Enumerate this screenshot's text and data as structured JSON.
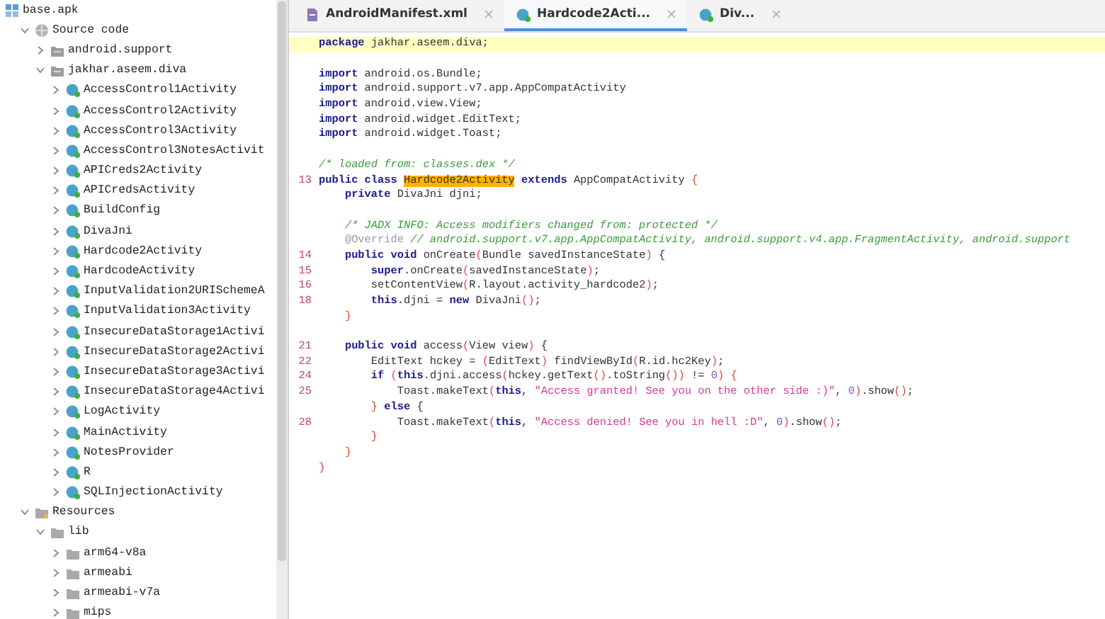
{
  "tree": {
    "label": "base.apk",
    "kind": "apk",
    "children": [
      {
        "label": "Source code",
        "kind": "source",
        "expanded": true,
        "children": [
          {
            "label": "android.support",
            "kind": "package",
            "expanded": false
          },
          {
            "label": "jakhar.aseem.diva",
            "kind": "package",
            "expanded": true,
            "children": [
              {
                "label": "AccessControl1Activity",
                "kind": "class",
                "expanded": false
              },
              {
                "label": "AccessControl2Activity",
                "kind": "class",
                "expanded": false
              },
              {
                "label": "AccessControl3Activity",
                "kind": "class",
                "expanded": false
              },
              {
                "label": "AccessControl3NotesActivit",
                "kind": "class",
                "expanded": false
              },
              {
                "label": "APICreds2Activity",
                "kind": "class",
                "expanded": false
              },
              {
                "label": "APICredsActivity",
                "kind": "class",
                "expanded": false
              },
              {
                "label": "BuildConfig",
                "kind": "class",
                "expanded": false
              },
              {
                "label": "DivaJni",
                "kind": "class",
                "expanded": false
              },
              {
                "label": "Hardcode2Activity",
                "kind": "class",
                "expanded": false
              },
              {
                "label": "HardcodeActivity",
                "kind": "class",
                "expanded": false
              },
              {
                "label": "InputValidation2URISchemeA",
                "kind": "class",
                "expanded": false
              },
              {
                "label": "InputValidation3Activity",
                "kind": "class",
                "expanded": false
              },
              {
                "label": "InsecureDataStorage1Activi",
                "kind": "class",
                "expanded": false
              },
              {
                "label": "InsecureDataStorage2Activi",
                "kind": "class",
                "expanded": false
              },
              {
                "label": "InsecureDataStorage3Activi",
                "kind": "class",
                "expanded": false
              },
              {
                "label": "InsecureDataStorage4Activi",
                "kind": "class",
                "expanded": false
              },
              {
                "label": "LogActivity",
                "kind": "class",
                "expanded": false
              },
              {
                "label": "MainActivity",
                "kind": "class",
                "expanded": false
              },
              {
                "label": "NotesProvider",
                "kind": "class",
                "expanded": false
              },
              {
                "label": "R",
                "kind": "class",
                "expanded": false
              },
              {
                "label": "SQLInjectionActivity",
                "kind": "class",
                "expanded": false
              }
            ]
          }
        ]
      },
      {
        "label": "Resources",
        "kind": "resources",
        "expanded": true,
        "children": [
          {
            "label": "lib",
            "kind": "folder",
            "expanded": true,
            "children": [
              {
                "label": "arm64-v8a",
                "kind": "folder",
                "expanded": false
              },
              {
                "label": "armeabi",
                "kind": "folder",
                "expanded": false
              },
              {
                "label": "armeabi-v7a",
                "kind": "folder",
                "expanded": false
              },
              {
                "label": "mips",
                "kind": "folder",
                "expanded": false
              }
            ]
          }
        ]
      }
    ]
  },
  "tabs": [
    {
      "label": "AndroidManifest.xml",
      "kind": "xml",
      "selected": false
    },
    {
      "label": "Hardcode2Acti...",
      "kind": "class",
      "selected": true
    },
    {
      "label": "Div...",
      "kind": "class",
      "selected": false
    }
  ],
  "code": {
    "lines": [
      {
        "current": true,
        "tokens": [
          {
            "kind": "kw",
            "text": "package"
          },
          {
            "kind": "plain",
            "text": " jakhar.aseem.diva;"
          }
        ]
      },
      {
        "current": false
      },
      {
        "current": false,
        "tokens": [
          {
            "kind": "kw",
            "text": "import"
          },
          {
            "kind": "plain",
            "text": " android.os.Bundle;"
          }
        ]
      },
      {
        "current": false,
        "tokens": [
          {
            "kind": "kw",
            "text": "import"
          },
          {
            "kind": "plain",
            "text": " android.support.v7.app.AppCompatActivity"
          }
        ]
      },
      {
        "current": false,
        "tokens": [
          {
            "kind": "kw",
            "text": "import"
          },
          {
            "kind": "plain",
            "text": " android.view.View;"
          }
        ]
      },
      {
        "current": false,
        "tokens": [
          {
            "kind": "kw",
            "text": "import"
          },
          {
            "kind": "plain",
            "text": " android.widget.EditText;"
          }
        ]
      },
      {
        "current": false,
        "tokens": [
          {
            "kind": "kw",
            "text": "import"
          },
          {
            "kind": "plain",
            "text": " android.widget.Toast;"
          }
        ]
      },
      {
        "current": false
      },
      {
        "current": false,
        "tokens": [
          {
            "kind": "comment",
            "text": "/* loaded from: classes.dex */"
          }
        ]
      },
      {
        "number": "13",
        "current": false,
        "tokens": [
          {
            "kind": "kw",
            "text": "public class "
          },
          {
            "kind": "match",
            "text": "Hardcode2Activity"
          },
          {
            "kind": "kw",
            "text": " extends"
          },
          {
            "kind": "plain",
            "text": " AppCompatActivity "
          },
          {
            "kind": "paren",
            "text": "{"
          }
        ]
      },
      {
        "current": false,
        "tokens": [
          {
            "kind": "kw",
            "text": "    private"
          },
          {
            "kind": "plain",
            "text": " DivaJni djni;"
          }
        ]
      },
      {
        "current": false
      },
      {
        "current": false,
        "tokens": [
          {
            "kind": "comment",
            "text": "    /* JADX INFO: Access modifiers changed from: protected */"
          }
        ]
      },
      {
        "current": false,
        "tokens": [
          {
            "kind": "anno",
            "text": "    @Override"
          },
          {
            "kind": "comment",
            "text": " // android.support.v7.app.AppCompatActivity, android.support.v4.app.FragmentActivity, android.support"
          }
        ]
      },
      {
        "number": "14",
        "current": false,
        "tokens": [
          {
            "kind": "kw",
            "text": "    public void"
          },
          {
            "kind": "plain",
            "text": " onCreate"
          },
          {
            "kind": "paren",
            "text": "("
          },
          {
            "kind": "plain",
            "text": "Bundle savedInstanceState"
          },
          {
            "kind": "paren",
            "text": ")"
          },
          {
            "kind": "plain",
            "text": " {"
          }
        ]
      },
      {
        "number": "15",
        "current": false,
        "tokens": [
          {
            "kind": "kw",
            "text": "        super"
          },
          {
            "kind": "plain",
            "text": ".onCreate"
          },
          {
            "kind": "paren",
            "text": "("
          },
          {
            "kind": "plain",
            "text": "savedInstanceState"
          },
          {
            "kind": "paren",
            "text": ")"
          },
          {
            "kind": "plain",
            "text": ";"
          }
        ]
      },
      {
        "number": "16",
        "current": false,
        "tokens": [
          {
            "kind": "plain",
            "text": "        setContentView"
          },
          {
            "kind": "paren",
            "text": "("
          },
          {
            "kind": "plain",
            "text": "R.layout.activity_hardcode2"
          },
          {
            "kind": "paren",
            "text": ")"
          },
          {
            "kind": "plain",
            "text": ";"
          }
        ]
      },
      {
        "number": "18",
        "current": false,
        "tokens": [
          {
            "kind": "kw",
            "text": "        this"
          },
          {
            "kind": "plain",
            "text": ".djni = "
          },
          {
            "kind": "kw",
            "text": "new"
          },
          {
            "kind": "plain",
            "text": " DivaJni"
          },
          {
            "kind": "paren",
            "text": "()"
          },
          {
            "kind": "plain",
            "text": ";"
          }
        ]
      },
      {
        "current": false,
        "tokens": [
          {
            "kind": "paren",
            "text": "    }"
          }
        ]
      },
      {
        "current": false
      },
      {
        "number": "21",
        "current": false,
        "tokens": [
          {
            "kind": "kw",
            "text": "    public void"
          },
          {
            "kind": "plain",
            "text": " access"
          },
          {
            "kind": "paren",
            "text": "("
          },
          {
            "kind": "plain",
            "text": "View view"
          },
          {
            "kind": "paren",
            "text": ")"
          },
          {
            "kind": "plain",
            "text": " {"
          }
        ]
      },
      {
        "number": "22",
        "current": false,
        "tokens": [
          {
            "kind": "plain",
            "text": "        EditText hckey = "
          },
          {
            "kind": "paren",
            "text": "("
          },
          {
            "kind": "plain",
            "text": "EditText"
          },
          {
            "kind": "paren",
            "text": ")"
          },
          {
            "kind": "plain",
            "text": " findViewById"
          },
          {
            "kind": "paren",
            "text": "("
          },
          {
            "kind": "plain",
            "text": "R.id.hc2Key"
          },
          {
            "kind": "paren",
            "text": ")"
          },
          {
            "kind": "plain",
            "text": ";"
          }
        ]
      },
      {
        "number": "24",
        "current": false,
        "tokens": [
          {
            "kind": "kw",
            "text": "        if"
          },
          {
            "kind": "paren",
            "text": " ("
          },
          {
            "kind": "kw",
            "text": "this"
          },
          {
            "kind": "plain",
            "text": ".djni.access"
          },
          {
            "kind": "paren",
            "text": "("
          },
          {
            "kind": "plain",
            "text": "hckey.getText"
          },
          {
            "kind": "paren",
            "text": "()"
          },
          {
            "kind": "plain",
            "text": ".toString"
          },
          {
            "kind": "paren",
            "text": "())"
          },
          {
            "kind": "plain",
            "text": " != "
          },
          {
            "kind": "num",
            "text": "0"
          },
          {
            "kind": "paren",
            "text": ") {"
          }
        ]
      },
      {
        "number": "25",
        "current": false,
        "tokens": [
          {
            "kind": "plain",
            "text": "            Toast.makeText"
          },
          {
            "kind": "paren",
            "text": "("
          },
          {
            "kind": "kw",
            "text": "this"
          },
          {
            "kind": "plain",
            "text": ", "
          },
          {
            "kind": "str",
            "text": "\"Access granted! See you on the other side :)\""
          },
          {
            "kind": "plain",
            "text": ", "
          },
          {
            "kind": "num",
            "text": "0"
          },
          {
            "kind": "paren",
            "text": ")"
          },
          {
            "kind": "plain",
            "text": ".show"
          },
          {
            "kind": "paren",
            "text": "()"
          },
          {
            "kind": "plain",
            "text": ";"
          }
        ]
      },
      {
        "current": false,
        "tokens": [
          {
            "kind": "paren",
            "text": "        }"
          },
          {
            "kind": "kw",
            "text": " else"
          },
          {
            "kind": "plain",
            "text": " {"
          }
        ]
      },
      {
        "number": "28",
        "current": false,
        "tokens": [
          {
            "kind": "plain",
            "text": "            Toast.makeText"
          },
          {
            "kind": "paren",
            "text": "("
          },
          {
            "kind": "kw",
            "text": "this"
          },
          {
            "kind": "plain",
            "text": ", "
          },
          {
            "kind": "str",
            "text": "\"Access denied! See you in hell :D\""
          },
          {
            "kind": "plain",
            "text": ", "
          },
          {
            "kind": "num",
            "text": "0"
          },
          {
            "kind": "paren",
            "text": ")"
          },
          {
            "kind": "plain",
            "text": ".show"
          },
          {
            "kind": "paren",
            "text": "()"
          },
          {
            "kind": "plain",
            "text": ";"
          }
        ]
      },
      {
        "current": false,
        "tokens": [
          {
            "kind": "paren",
            "text": "        }"
          }
        ]
      },
      {
        "current": false,
        "tokens": [
          {
            "kind": "paren",
            "text": "    }"
          }
        ]
      },
      {
        "current": false,
        "tokens": [
          {
            "kind": "paren",
            "text": "}"
          }
        ]
      }
    ]
  }
}
